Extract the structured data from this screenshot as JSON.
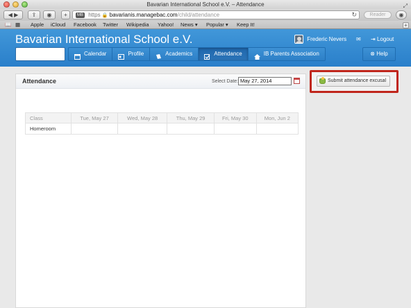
{
  "browser": {
    "window_title": "Bavarian International School e.V. – Attendance",
    "url": {
      "badge": "MB",
      "scheme": "https",
      "domain": "bavarianis.managebac.com",
      "path": "/child/attendance"
    },
    "reader_label": "Reader",
    "bookmarks": [
      "Apple",
      "iCloud",
      "Facebook",
      "Twitter",
      "Wikipedia",
      "Yahoo!",
      "News ▾",
      "Popular ▾",
      "Keep It!"
    ]
  },
  "header": {
    "school_name": "Bavarian International School e.V.",
    "user_name": "Frederic Nevers",
    "logout_label": "Logout",
    "help_label": "Help",
    "nav_tabs": [
      {
        "label": "Calendar",
        "icon": "calendar-icon"
      },
      {
        "label": "Profile",
        "icon": "profile-icon"
      },
      {
        "label": "Academics",
        "icon": "book-icon"
      },
      {
        "label": "Attendance",
        "icon": "checkbox-icon",
        "active": true
      },
      {
        "label": "IB Parents Association",
        "icon": "home-icon"
      }
    ]
  },
  "attendance": {
    "title": "Attendance",
    "select_date_label": "Select Date:",
    "selected_date": "May 27, 2014",
    "columns": [
      "Class",
      "Tue, May 27",
      "Wed, May 28",
      "Thu, May 29",
      "Fri, May 30",
      "Mon, Jun 2"
    ],
    "rows": [
      {
        "label": "Homeroom",
        "cells": [
          "",
          "",
          "",
          "",
          ""
        ]
      }
    ]
  },
  "actions": {
    "submit_excusal_label": "Submit attendance excusal"
  },
  "colors": {
    "header_blue": "#2a7fca",
    "highlight_red": "#c0261c"
  }
}
